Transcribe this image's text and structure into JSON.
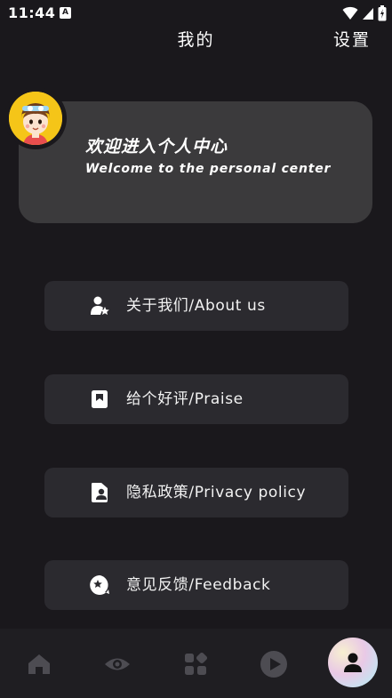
{
  "status_bar": {
    "time": "11:44",
    "indicator": "A",
    "icons": [
      "wifi-icon",
      "signal-icon",
      "battery-icon"
    ]
  },
  "header": {
    "title": "我的",
    "settings_label": "设置"
  },
  "welcome": {
    "title": "欢迎进入个人中心",
    "subtitle": "Welcome to the personal center",
    "avatar_icon": "cartoon-avatar-icon"
  },
  "menu": [
    {
      "label": "关于我们/About us",
      "icon": "user-star-icon"
    },
    {
      "label": "给个好评/Praise",
      "icon": "bookmark-icon"
    },
    {
      "label": "隐私政策/Privacy policy",
      "icon": "user-card-icon"
    },
    {
      "label": "意见反馈/Feedback",
      "icon": "feedback-star-icon"
    }
  ],
  "nav": [
    {
      "icon": "home-icon",
      "active": false
    },
    {
      "icon": "eye-icon",
      "active": false
    },
    {
      "icon": "grid-icon",
      "active": false
    },
    {
      "icon": "play-icon",
      "active": false
    },
    {
      "icon": "user-icon",
      "active": true
    }
  ],
  "colors": {
    "background": "#1a181c",
    "card": "#3b3a3c",
    "menu_item": "#2b2a2f",
    "nav_inactive": "#4d4c52",
    "avatar_bg": "#f5c518"
  }
}
